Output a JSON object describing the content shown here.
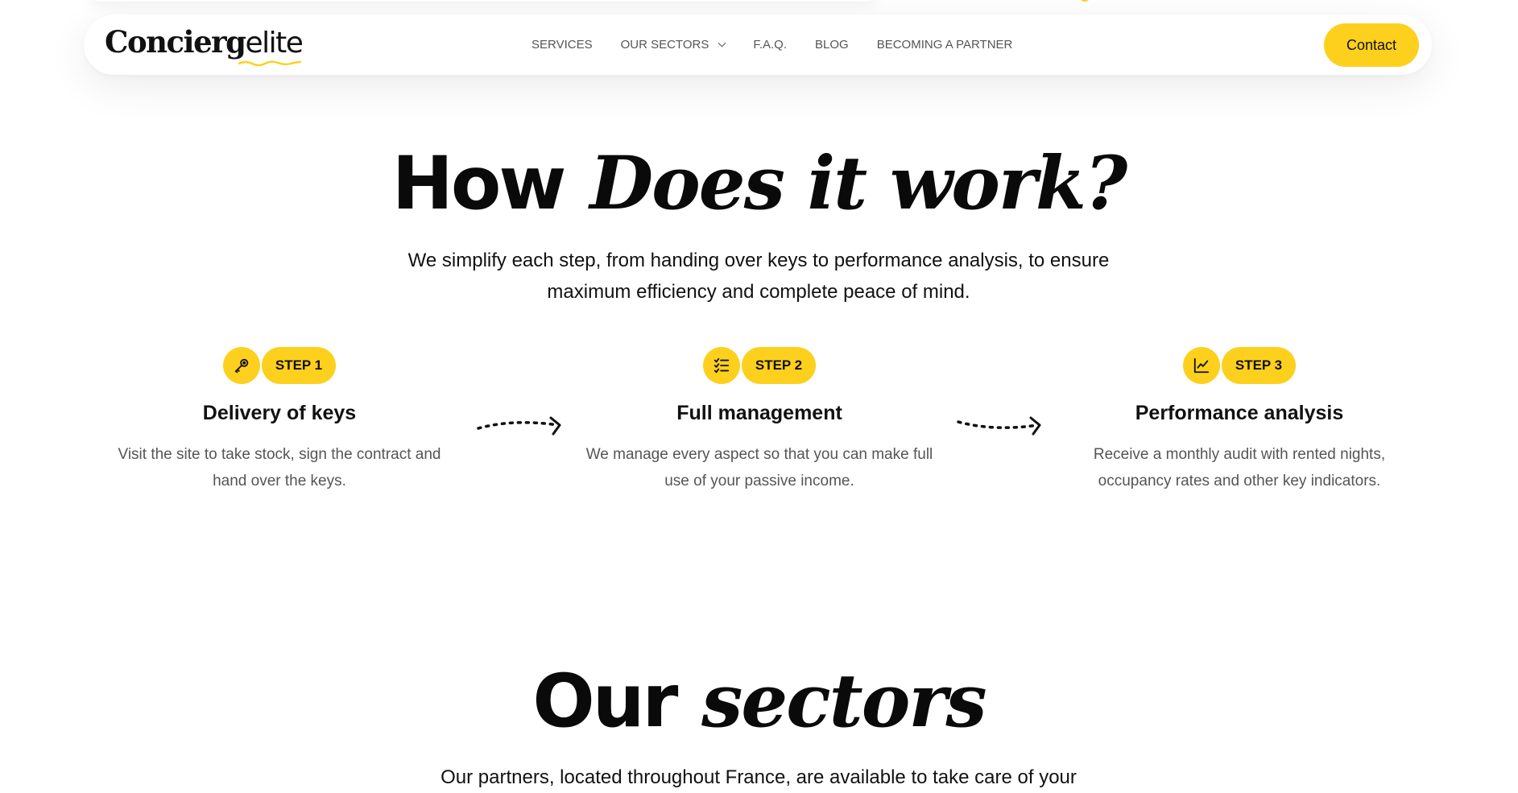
{
  "header": {
    "logo_bold": "Concierg",
    "logo_light": "elite",
    "nav": [
      {
        "label": "SERVICES"
      },
      {
        "label": "OUR SECTORS"
      },
      {
        "label": "F.A.Q."
      },
      {
        "label": "BLOG"
      },
      {
        "label": "BECOMING A PARTNER"
      }
    ],
    "contact_label": "Contact"
  },
  "how": {
    "title_plain": "How",
    "title_italic": "Does it work?",
    "subtitle": "We simplify each step, from handing over keys to performance analysis, to ensure maximum efficiency and complete peace of mind.",
    "steps": [
      {
        "badge": "STEP 1",
        "icon": "key-icon",
        "title": "Delivery of keys",
        "desc": "Visit the site to take stock, sign the contract and hand over the keys."
      },
      {
        "badge": "STEP 2",
        "icon": "checklist-icon",
        "title": "Full management",
        "desc": "We manage every aspect so that you can make full use of your passive income."
      },
      {
        "badge": "STEP 3",
        "icon": "chart-line-icon",
        "title": "Performance analysis",
        "desc": "Receive a monthly audit with rented nights, occupancy rates and other key indicators."
      }
    ]
  },
  "sectors": {
    "title_plain": "Our",
    "title_italic": "sectors",
    "subtitle": "Our partners, located throughout France, are available to take care of your"
  },
  "colors": {
    "accent": "#FDD01E",
    "text": "#111111",
    "muted": "#555555"
  }
}
